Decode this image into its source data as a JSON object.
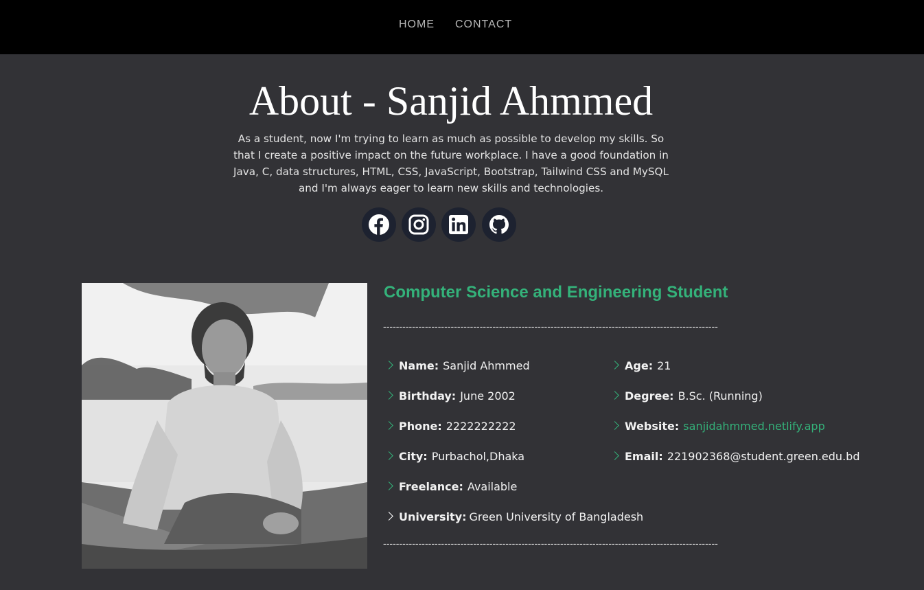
{
  "nav": {
    "home": "HOME",
    "contact": "CONTACT"
  },
  "hero": {
    "title": "About - Sanjid Ahmmed",
    "intro": "As a student, now I'm trying to learn as much as possible to develop my skills. So that I create a positive impact on the future workplace. I have a good foundation in Java, C, data structures, HTML, CSS, JavaScript, Bootstrap, Tailwind CSS and MySQL and I'm always eager to learn new skills and technologies."
  },
  "social": [
    {
      "icon": "facebook-icon"
    },
    {
      "icon": "instagram-icon"
    },
    {
      "icon": "linkedin-icon"
    },
    {
      "icon": "github-icon"
    }
  ],
  "profile": {
    "role": "Computer Science and Engineering Student",
    "separator": "--------------------------------------------------------------------------------------------------------",
    "details": {
      "name": {
        "label": "Name:",
        "value": "Sanjid Ahmmed"
      },
      "age": {
        "label": "Age:",
        "value": "21"
      },
      "birthday": {
        "label": "Birthday:",
        "value": "June 2002"
      },
      "degree": {
        "label": "Degree:",
        "value": "B.Sc. (Running)"
      },
      "phone": {
        "label": "Phone:",
        "value": "2222222222"
      },
      "website": {
        "label": "Website:",
        "value": "sanjidahmmed.netlify.app"
      },
      "city": {
        "label": "City:",
        "value": "Purbachol,Dhaka"
      },
      "email": {
        "label": "Email:",
        "value": "221902368@student.green.edu.bd"
      },
      "freelance": {
        "label": "Freelance:",
        "value": "Available"
      },
      "university": {
        "label": "University:",
        "value": "Green University of Bangladesh"
      }
    }
  },
  "colors": {
    "accent": "#34b27a",
    "background": "#323236",
    "navbar": "#000000",
    "social_bg": "#1d2230"
  }
}
